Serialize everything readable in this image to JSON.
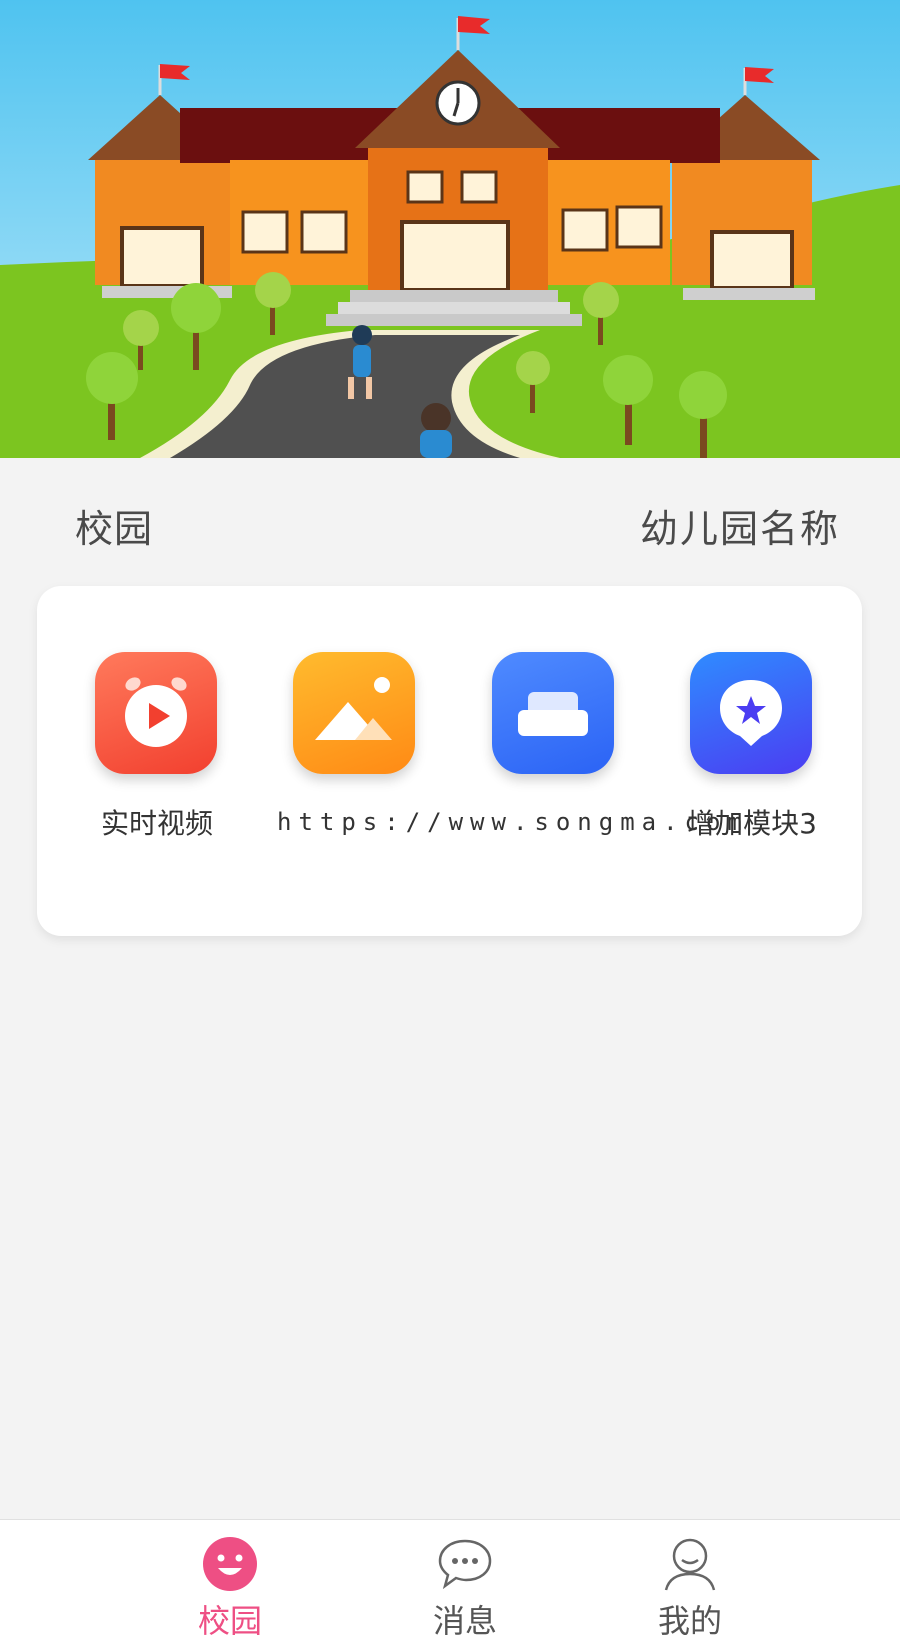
{
  "banner": {
    "alt": "school-illustration"
  },
  "header": {
    "left_title": "校园",
    "right_title": "幼儿园名称"
  },
  "modules": [
    {
      "label": "实时视频",
      "icon": "video-play-icon",
      "color": "#f2402f"
    },
    {
      "label": "",
      "icon": "photo-album-icon",
      "color": "#ff8a15"
    },
    {
      "label": "",
      "icon": "sofa-icon",
      "color": "#2b63f5"
    },
    {
      "label": "增加模块3",
      "icon": "star-badge-icon",
      "color": "#4b3df2"
    }
  ],
  "watermark": "https://www.songma.com",
  "tabbar": {
    "active_color": "#ee4f84",
    "items": [
      {
        "label": "校园",
        "icon": "smile-face-icon",
        "active": true
      },
      {
        "label": "消息",
        "icon": "chat-bubble-icon",
        "active": false
      },
      {
        "label": "我的",
        "icon": "user-profile-icon",
        "active": false
      }
    ]
  }
}
